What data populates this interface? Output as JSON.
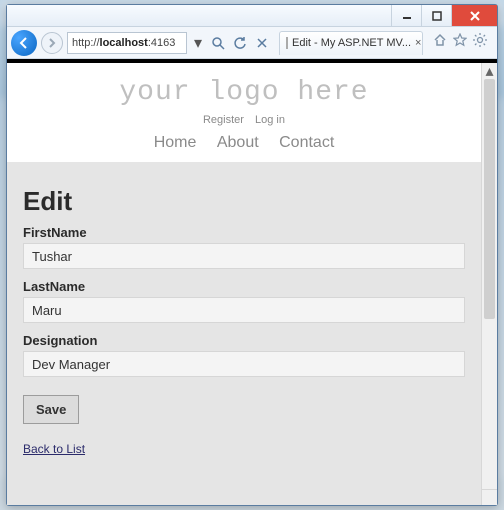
{
  "browser": {
    "url_prefix": "http://",
    "host": "localhost",
    "port": ":4163",
    "tab_title": "Edit - My ASP.NET MV..."
  },
  "site": {
    "logo": "your logo here",
    "auth": {
      "register": "Register",
      "login": "Log in"
    },
    "nav": {
      "home": "Home",
      "about": "About",
      "contact": "Contact"
    }
  },
  "page": {
    "title": "Edit",
    "fields": {
      "first": {
        "label": "FirstName",
        "value": "Tushar"
      },
      "last": {
        "label": "LastName",
        "value": "Maru"
      },
      "desig": {
        "label": "Designation",
        "value": "Dev Manager"
      }
    },
    "save": "Save",
    "back": "Back to List"
  }
}
